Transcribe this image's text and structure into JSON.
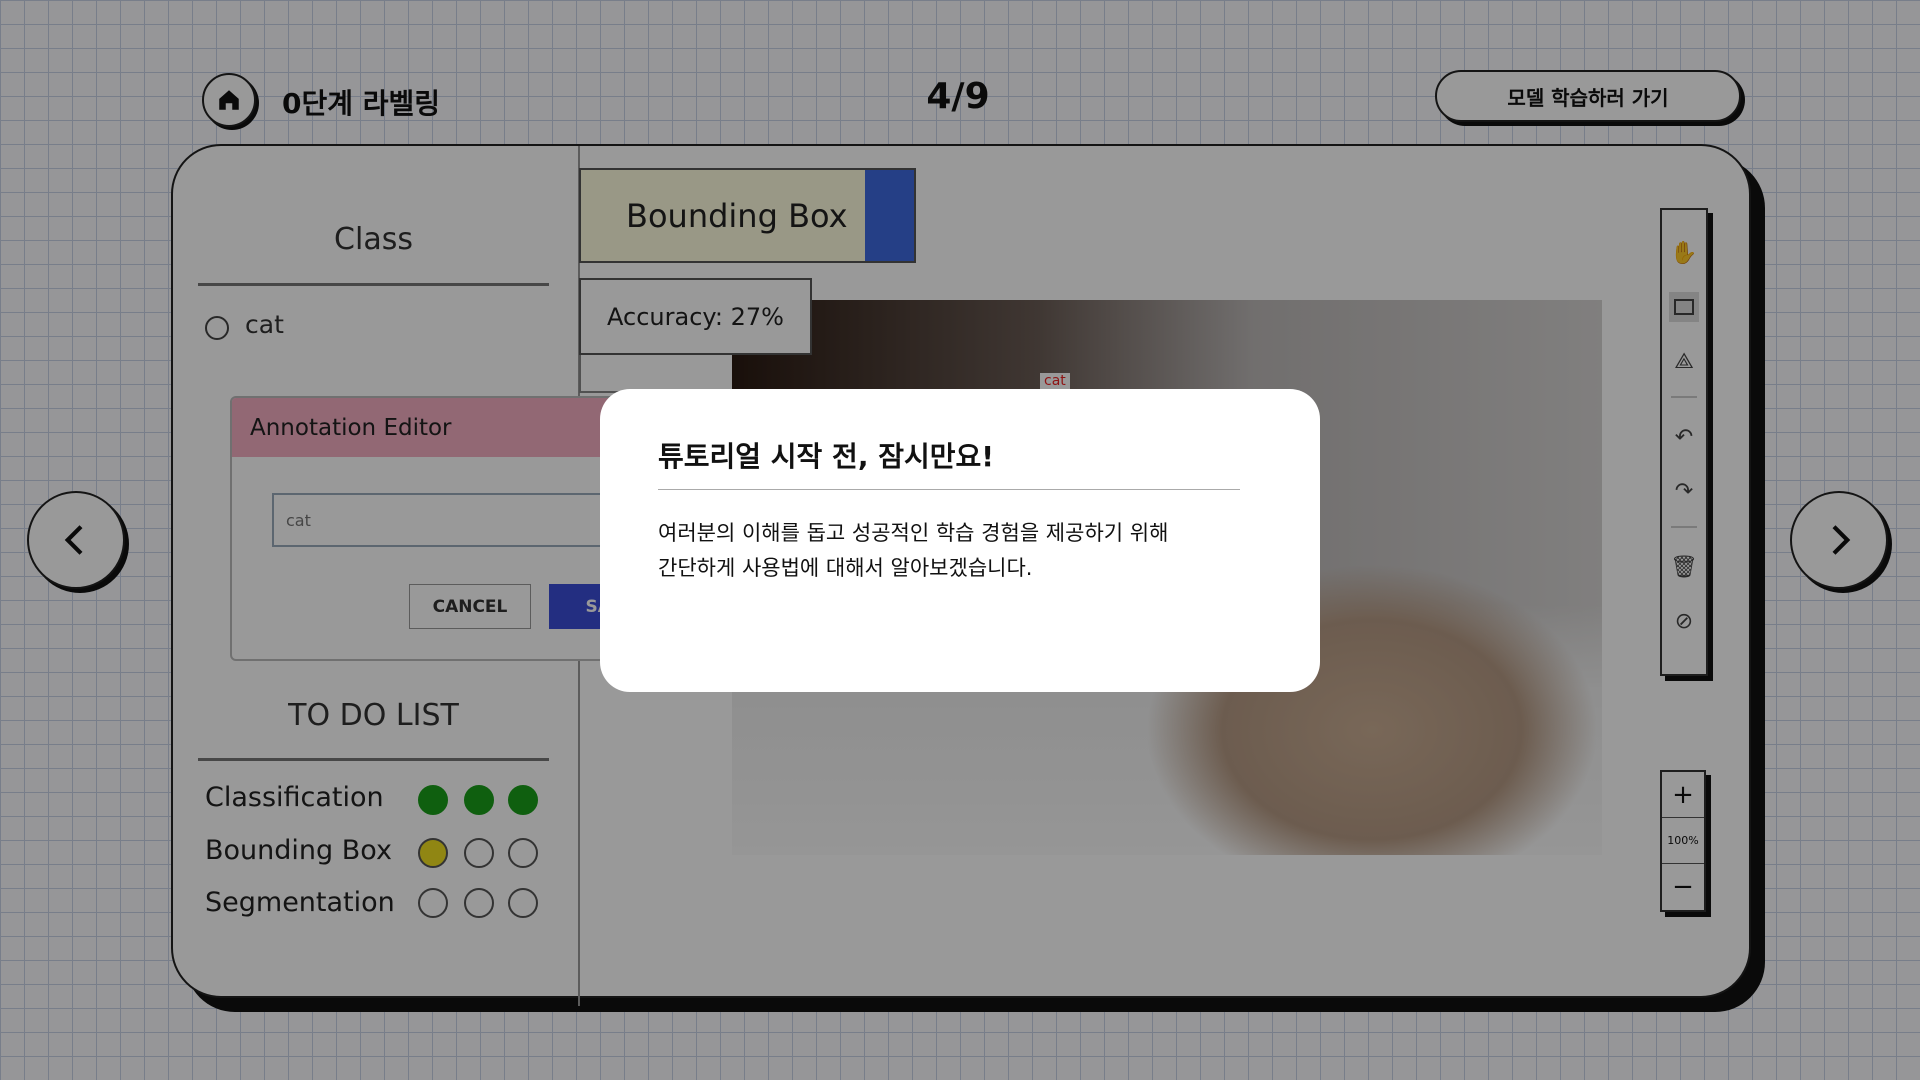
{
  "header": {
    "title": "0단계 라벨링",
    "page": "4/9",
    "model_button": "모델 학습하러 가기"
  },
  "class_panel": {
    "heading": "Class",
    "classes": [
      {
        "label": "cat",
        "selected": false
      }
    ]
  },
  "annotation_editor": {
    "title": "Annotation Editor",
    "input_placeholder": "cat",
    "cancel_label": "CANCEL",
    "save_label": "SAVE"
  },
  "todo": {
    "heading": "TO DO LIST",
    "rows": [
      {
        "label": "Classification",
        "progress": [
          "done",
          "done",
          "done"
        ]
      },
      {
        "label": "Bounding Box",
        "progress": [
          "current",
          "empty",
          "empty"
        ]
      },
      {
        "label": "Segmentation",
        "progress": [
          "empty",
          "empty",
          "empty"
        ]
      }
    ]
  },
  "colors": {
    "done": "#1a9e1a",
    "current": "#f0e020",
    "tab_accent": "#3f6ae0",
    "editor_header": "#f4aec2",
    "save": "#3b4ed8"
  },
  "workspace": {
    "tab_label": "Bounding Box",
    "accuracy": "Accuracy: 27%",
    "box_label": "cat"
  },
  "toolbar": {
    "tools": [
      "hand-icon",
      "rectangle-icon",
      "polygon-icon",
      "undo-icon",
      "redo-icon",
      "delete-icon",
      "hide-icon"
    ],
    "zoom_level": "100%",
    "zoom_in": "+",
    "zoom_out": "−"
  },
  "modal": {
    "title": "튜토리얼 시작 전, 잠시만요!",
    "body_line1": "여러분의 이해를 돕고 성공적인 학습 경험을 제공하기 위해",
    "body_line2": "간단하게 사용법에 대해서 알아보겠습니다."
  }
}
